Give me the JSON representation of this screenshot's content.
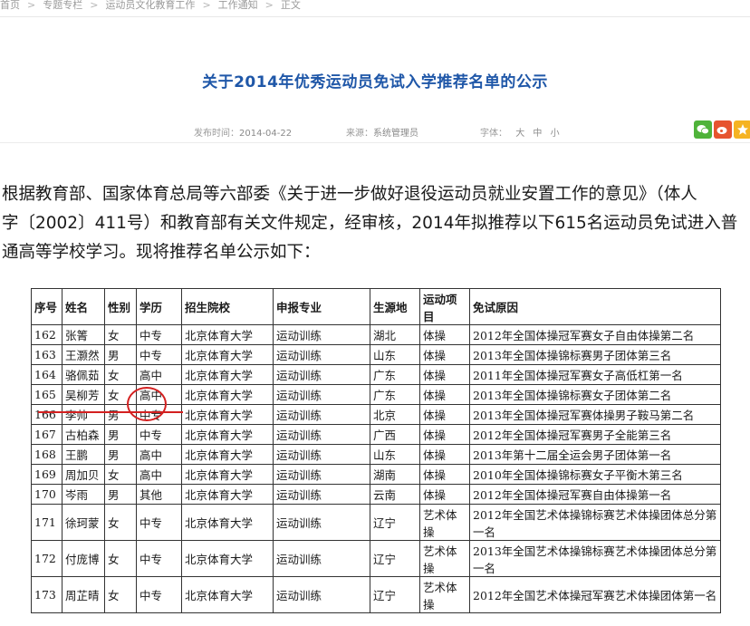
{
  "breadcrumb": [
    "首页",
    "专题专栏",
    "运动员文化教育工作",
    "工作通知",
    "正文"
  ],
  "article": {
    "title": "关于2014年优秀运动员免试入学推荐名单的公示",
    "date_label": "发布时间：",
    "date": "2014-04-22",
    "source_label": "来源：",
    "source": "系统管理员",
    "font_label": "字体：",
    "font_sizes": [
      "大",
      "中",
      "小"
    ]
  },
  "share_icons": [
    "wechat-icon",
    "weibo-icon",
    "qzone-icon"
  ],
  "body_lines": [
    "根据教育部、国家体育总局等六部委《关于进一步做好退役运动员就业安置工作的意见》（体人",
    "字〔2002〕411号）和教育部有关文件规定，经审核，2014年拟推荐以下615名运动员免试进入普",
    "通高等学校学习。现将推荐名单公示如下："
  ],
  "table": {
    "headers": [
      "序号",
      "姓名",
      "性别",
      "学历",
      "招生院校",
      "申报专业",
      "生源地",
      "运动项目",
      "免试原因"
    ],
    "rows": [
      [
        "162",
        "张箐",
        "女",
        "中专",
        "北京体育大学",
        "运动训练",
        "湖北",
        "体操",
        "2012年全国体操冠军赛女子自由体操第二名"
      ],
      [
        "163",
        "王灏然",
        "男",
        "中专",
        "北京体育大学",
        "运动训练",
        "山东",
        "体操",
        "2013年全国体操锦标赛男子团体第三名"
      ],
      [
        "164",
        "骆佩茹",
        "女",
        "高中",
        "北京体育大学",
        "运动训练",
        "广东",
        "体操",
        "2011年全国体操冠军赛女子高低杠第一名"
      ],
      [
        "165",
        "吴柳芳",
        "女",
        "高中",
        "北京体育大学",
        "运动训练",
        "广东",
        "体操",
        "2013年全国体操锦标赛女子团体第二名"
      ],
      [
        "166",
        "李帅",
        "男",
        "中专",
        "北京体育大学",
        "运动训练",
        "北京",
        "体操",
        "2013年全国体操冠军赛体操男子鞍马第二名"
      ],
      [
        "167",
        "古柏森",
        "男",
        "中专",
        "北京体育大学",
        "运动训练",
        "广西",
        "体操",
        "2012年全国体操冠军赛男子全能第三名"
      ],
      [
        "168",
        "王鹏",
        "男",
        "高中",
        "北京体育大学",
        "运动训练",
        "山东",
        "体操",
        "2013年第十二届全运会男子团体第一名"
      ],
      [
        "169",
        "周加贝",
        "女",
        "高中",
        "北京体育大学",
        "运动训练",
        "湖南",
        "体操",
        "2010年全国体操锦标赛女子平衡木第三名"
      ],
      [
        "170",
        "岑雨",
        "男",
        "其他",
        "北京体育大学",
        "运动训练",
        "云南",
        "体操",
        "2012年全国体操冠军赛自由体操第一名"
      ],
      [
        "171",
        "徐珂蒙",
        "女",
        "中专",
        "北京体育大学",
        "运动训练",
        "辽宁",
        "艺术体操",
        "2012年全国艺术体操锦标赛艺术体操团体总分第一名"
      ],
      [
        "172",
        "付庞博",
        "女",
        "中专",
        "北京体育大学",
        "运动训练",
        "辽宁",
        "艺术体操",
        "2013年全国艺术体操锦标赛艺术体操团体总分第一名"
      ],
      [
        "173",
        "周芷晴",
        "女",
        "中专",
        "北京体育大学",
        "运动训练",
        "辽宁",
        "艺术体操",
        "2012年全国艺术体操冠军赛艺术体操团体第一名"
      ]
    ]
  },
  "annotation": {
    "color": "#d42020"
  }
}
